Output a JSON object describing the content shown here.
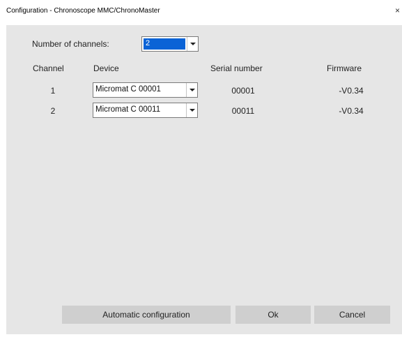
{
  "window": {
    "title": "Configuration - Chronoscope MMC/ChronoMaster",
    "close_glyph": "×"
  },
  "channels_setting": {
    "label": "Number of channels:",
    "value": "2"
  },
  "table": {
    "headers": {
      "channel": "Channel",
      "device": "Device",
      "serial": "Serial number",
      "firmware": "Firmware"
    },
    "rows": [
      {
        "channel": "1",
        "device": "Micromat C 00001",
        "serial": "00001",
        "firmware": "-V0.34"
      },
      {
        "channel": "2",
        "device": "Micromat C 00011",
        "serial": "00011",
        "firmware": "-V0.34"
      }
    ]
  },
  "buttons": {
    "auto_config": "Automatic configuration",
    "ok": "Ok",
    "cancel": "Cancel"
  },
  "colors": {
    "body_bg": "#e6e6e6",
    "selection": "#0b63d6",
    "button_bg": "#cfcfcf"
  }
}
